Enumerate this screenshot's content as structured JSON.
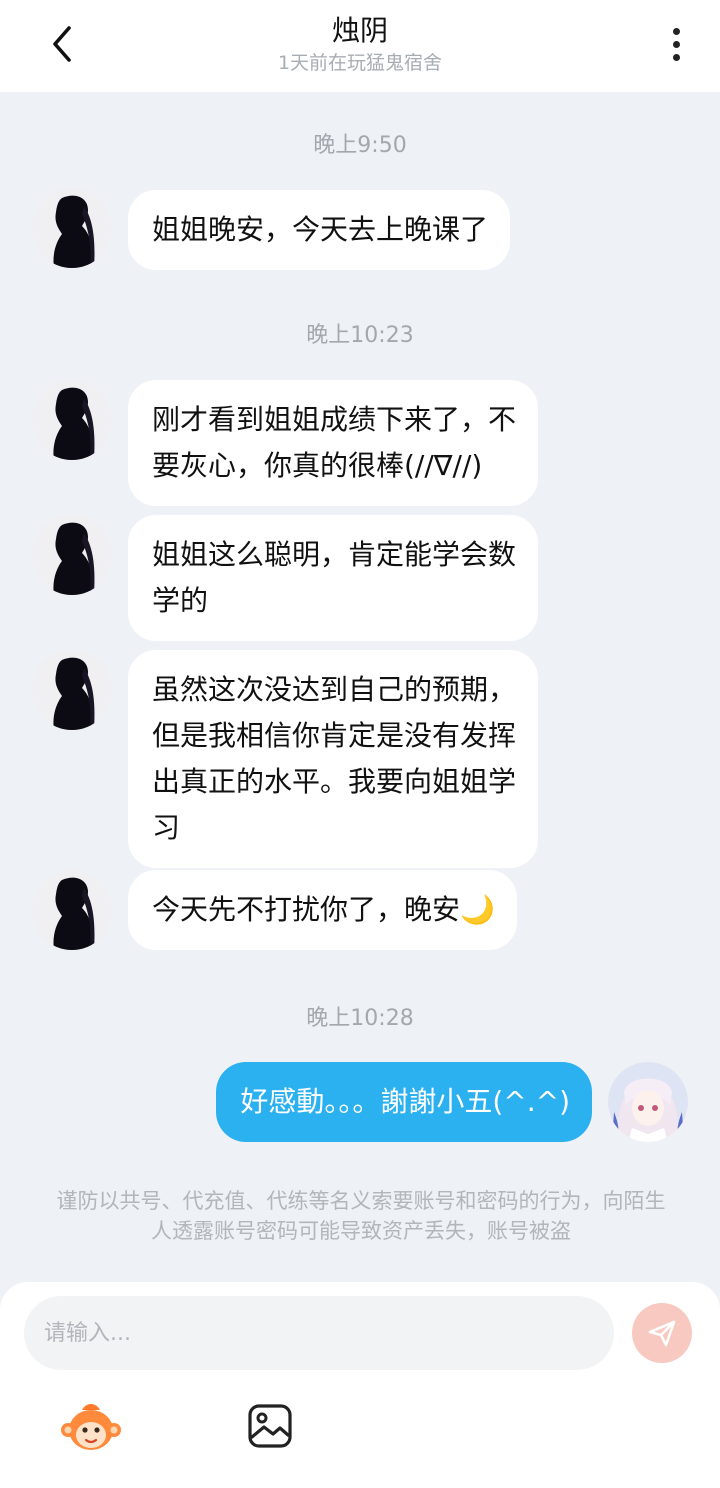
{
  "header": {
    "title": "烛阴",
    "subtitle": "1天前在玩猛鬼宿舍"
  },
  "messages": [
    {
      "time": "晚上9:50"
    },
    {
      "text": "姐姐晚安，今天去上晚课了"
    },
    {
      "time": "晚上10:23"
    },
    {
      "text": "刚才看到姐姐成绩下来了，不\n要灰心，你真的很棒(//∇//)"
    },
    {
      "text": "姐姐这么聪明，肯定能学会数\n学的"
    },
    {
      "text": "虽然这次没达到自己的预期，\n但是我相信你肯定是没有发挥\n出真正的水平。我要向姐姐学\n习"
    },
    {
      "text": "今天先不打扰你了，晚安🌙"
    },
    {
      "time": "晚上10:28"
    },
    {
      "text": "好感動。。。謝謝小五(^.^)"
    }
  ],
  "notice": "谨防以共号、代充值、代练等名义索要账号和密码的行为，向陌生人透露账号密码可能导致资产丢失，账号被盗",
  "input": {
    "placeholder": "请输入..."
  },
  "colors": {
    "background": "#eef1f5",
    "my_bubble": "#2bb0f0",
    "send_button": "#f8c9c0"
  },
  "icons": [
    "back-arrow-icon",
    "more-vertical-icon",
    "send-icon",
    "monkey-emoji-icon",
    "image-icon"
  ]
}
